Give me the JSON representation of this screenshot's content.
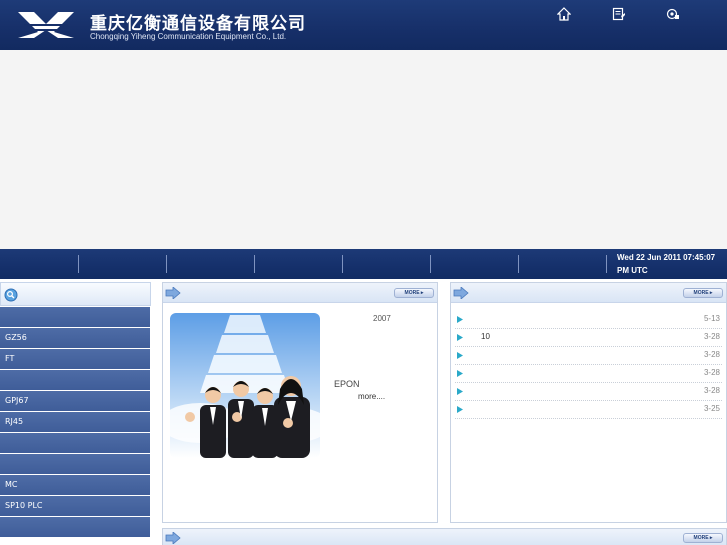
{
  "header": {
    "company_cn": "重庆亿衡通信设备有限公司",
    "company_en": "Chongqing Yiheng Communication Equipment Co., Ltd.",
    "icons": [
      "home-icon",
      "document-edit-icon",
      "favorite-icon"
    ]
  },
  "navbar": {
    "datetime_line1": "Wed 22 Jun 2011 07:45:07",
    "datetime_line2": "PM UTC"
  },
  "sidebar": {
    "items": [
      {
        "label": ""
      },
      {
        "label": "GZ56"
      },
      {
        "label": "FT"
      },
      {
        "label": ""
      },
      {
        "label": "GPJ67"
      },
      {
        "label": "RJ45"
      },
      {
        "label": ""
      },
      {
        "label": ""
      },
      {
        "label": "MC"
      },
      {
        "label": "SP10  PLC"
      },
      {
        "label": ""
      }
    ]
  },
  "about_panel": {
    "more_button": "MORE",
    "year": "2007",
    "epon": "EPON",
    "more_link": "more...."
  },
  "news_panel": {
    "more_button": "MORE",
    "items": [
      {
        "title": "",
        "date": "5-13"
      },
      {
        "title": "10",
        "date": "3-28"
      },
      {
        "title": "",
        "date": "3-28"
      },
      {
        "title": "",
        "date": "3-28"
      },
      {
        "title": "",
        "date": "3-28"
      },
      {
        "title": "",
        "date": "3-25"
      }
    ]
  },
  "bottom_panel": {
    "more_button": "MORE"
  },
  "colors": {
    "header_bg": "#17306a",
    "sidebar_item_bg": "#4664a0",
    "panel_bar": "#dfe8f6",
    "bullet": "#2aa9c9"
  }
}
